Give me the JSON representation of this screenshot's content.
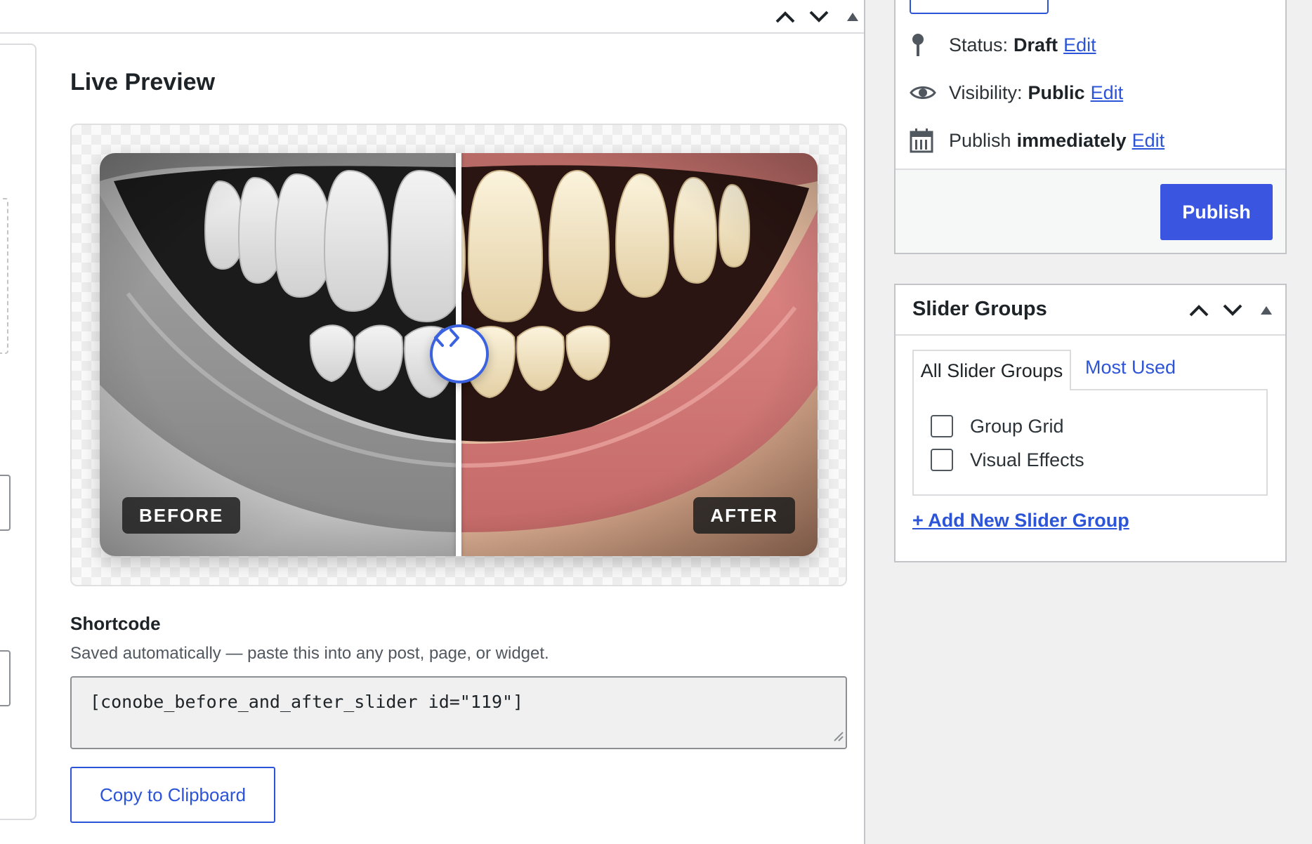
{
  "main": {
    "section_title": "Live Preview",
    "slider": {
      "before_label": "BEFORE",
      "after_label": "AFTER",
      "divider_position": 0.5,
      "handle_color": "#3b63e0"
    },
    "shortcode": {
      "title": "Shortcode",
      "help_text": "Saved automatically — paste this into any post, page, or widget.",
      "value": "[conobe_before_and_after_slider id=\"119\"]"
    },
    "copy_button_label": "Copy to Clipboard",
    "header_icons": [
      "chevron-up-icon",
      "chevron-down-icon",
      "triangle-up-icon"
    ]
  },
  "publish": {
    "status_label": "Status:",
    "status_value": "Draft",
    "visibility_label": "Visibility:",
    "visibility_value": "Public",
    "schedule_label": "Publish",
    "schedule_value": "immediately",
    "edit_label": "Edit",
    "publish_button_label": "Publish",
    "icons": [
      "pin-icon",
      "eye-icon",
      "calendar-icon"
    ]
  },
  "slider_groups": {
    "title": "Slider Groups",
    "tabs": [
      "All Slider Groups",
      "Most Used"
    ],
    "items": [
      {
        "label": "Group Grid",
        "checked": false
      },
      {
        "label": "Visual Effects",
        "checked": false
      }
    ],
    "add_new_label": "+ Add New Slider Group"
  },
  "colors": {
    "accent": "#2c54d9",
    "publish_button": "#3a56e0",
    "panel_border": "#c3c4c7"
  }
}
